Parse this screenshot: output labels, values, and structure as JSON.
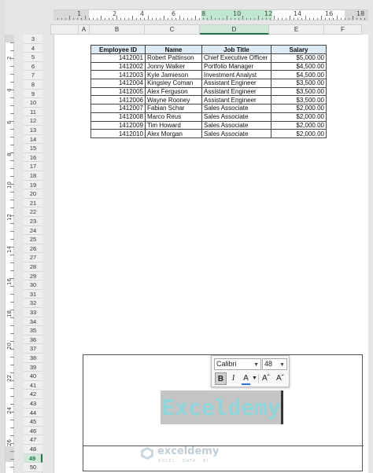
{
  "ruler": {
    "numbers": [
      "1",
      "2",
      "4",
      "6",
      "8",
      "10",
      "12",
      "14",
      "16",
      "18"
    ]
  },
  "columns": [
    "A",
    "B",
    "C",
    "D",
    "E",
    "F"
  ],
  "rows": [
    "3",
    "4",
    "5",
    "6",
    "7",
    "8",
    "9",
    "10",
    "11",
    "12",
    "13",
    "14",
    "15",
    "16",
    "17",
    "18",
    "19",
    "20",
    "21",
    "22",
    "23",
    "24",
    "25",
    "26",
    "27",
    "28",
    "29",
    "30",
    "31",
    "32",
    "33",
    "34",
    "35",
    "36",
    "37",
    "38",
    "39",
    "40",
    "41",
    "42",
    "43",
    "44",
    "45",
    "46",
    "47",
    "48",
    "49",
    "50"
  ],
  "selected_row": "49",
  "vruler_numbers": [
    "2",
    "4",
    "6",
    "8",
    "10",
    "12",
    "14",
    "16",
    "18",
    "20",
    "22",
    "24",
    "26"
  ],
  "table": {
    "headers": [
      "Employee ID",
      "Name",
      "Job Title",
      "Salary"
    ],
    "rows": [
      [
        "1412001",
        "Robert Pattinson",
        "Chief Executive Officer",
        "$5,000.00"
      ],
      [
        "1412002",
        "Jonny Walker",
        "Portfolio Manager",
        "$4,500.00"
      ],
      [
        "1412003",
        "Kyle Jamieson",
        "Investment Analyst",
        "$4,500.00"
      ],
      [
        "1412004",
        "Kingsley Coman",
        "Assistant Engineer",
        "$3,500.00"
      ],
      [
        "1412005",
        "Alex Ferguson",
        "Assistant Engineer",
        "$3,500.00"
      ],
      [
        "1412006",
        "Wayne Rooney",
        "Assistant Engineer",
        "$3,500.00"
      ],
      [
        "1412007",
        "Fabian Schar",
        "Sales Associate",
        "$2,000.00"
      ],
      [
        "1412008",
        "Marco Reus",
        "Sales Associate",
        "$2,000.00"
      ],
      [
        "1412009",
        "Tim Howard",
        "Sales Associate",
        "$2,000.00"
      ],
      [
        "1412010",
        "Alex Morgan",
        "Sales Associate",
        "$2,000.00"
      ]
    ]
  },
  "minitoolbar": {
    "font_name": "Calibri",
    "font_size": "48",
    "bold_label": "B",
    "italic_label": "I",
    "font_color_label": "A",
    "grow_label": "Aˆ",
    "shrink_label": "Aˇ",
    "font_color": "#2f6fd1"
  },
  "footer": {
    "selected_text": "Exceldemy",
    "text_color": "#8fd4d9"
  },
  "watermark": {
    "name": "exceldemy",
    "tagline": "EXCEL · DATA · BI"
  },
  "colors": {
    "accent": "#217346",
    "header_fill": "#ddebf7",
    "ruler_highlight": "#bfe7cf"
  }
}
